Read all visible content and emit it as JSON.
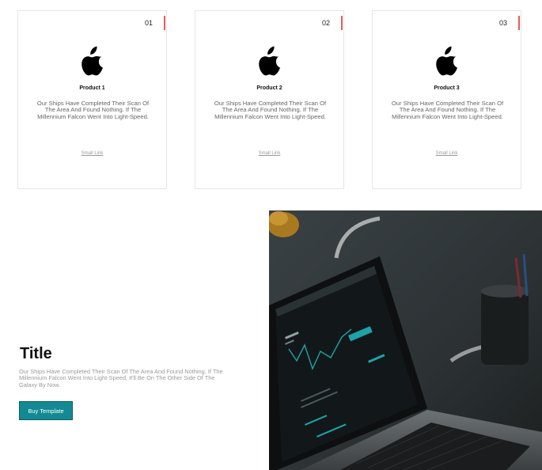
{
  "cards": [
    {
      "number": "01",
      "icon": "apple-logo-icon",
      "title": "Product 1",
      "description": "Our Ships Have Completed Their Scan Of The Area And Found Nothing. If The Millennium Falcon Went Into Light-Speed.",
      "link": "Small Link"
    },
    {
      "number": "02",
      "icon": "apple-logo-icon",
      "title": "Product 2",
      "description": "Our Ships Have Completed Their Scan Of The Area And Found Nothing. If The Millennium Falcon Went Into Light-Speed.",
      "link": "Small Link"
    },
    {
      "number": "03",
      "icon": "apple-logo-icon",
      "title": "Product 3",
      "description": "Our Ships Have Completed Their Scan Of The Area And Found Nothing. If The Millennium Falcon Went Into Light-Speed.",
      "link": "Small Link"
    }
  ],
  "hero": {
    "title": "Title",
    "description": "Our Ships Have Completed Their Scan Of The Area And Found Nothing. If The Millennium Falcon Went Into Light-Speed, It'll Be On The Other Side Of The Galaxy By Now.",
    "button_label": "Buy Template",
    "image": "laptop-photo"
  },
  "colors": {
    "accent_bar": "#e65b5b",
    "button": "#138a93"
  }
}
